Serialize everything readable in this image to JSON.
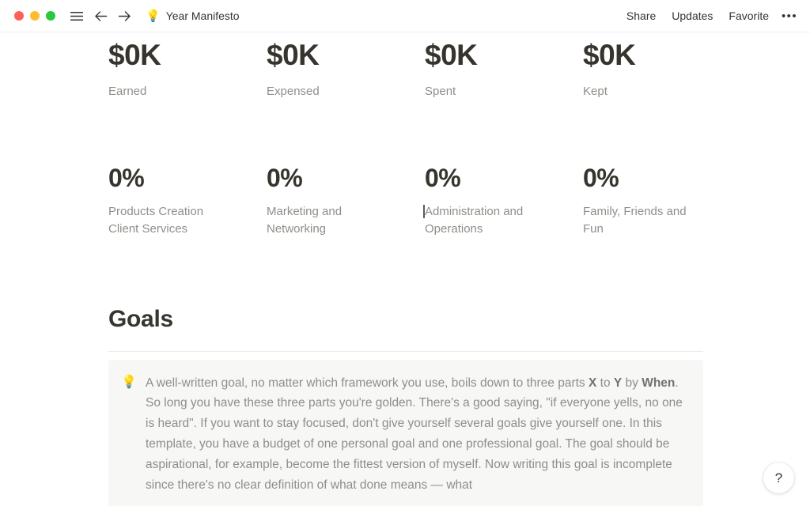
{
  "window": {
    "traffic_lights": [
      {
        "name": "close",
        "color": "#ff5f57"
      },
      {
        "name": "minimize",
        "color": "#febc2e"
      },
      {
        "name": "maximize",
        "color": "#28c840"
      }
    ],
    "menu_icon": "hamburger-icon",
    "back_icon": "arrow-left-icon",
    "forward_icon": "arrow-right-icon",
    "doc_emoji": "💡",
    "doc_title": "Year Manifesto",
    "actions": [
      {
        "name": "share",
        "label": "Share"
      },
      {
        "name": "updates",
        "label": "Updates"
      },
      {
        "name": "favorite",
        "label": "Favorite"
      }
    ],
    "more_label": "•••"
  },
  "stats_money": [
    {
      "value": "$0K",
      "label": "Earned"
    },
    {
      "value": "$0K",
      "label": "Expensed"
    },
    {
      "value": "$0K",
      "label": "Spent"
    },
    {
      "value": "$0K",
      "label": "Kept"
    }
  ],
  "stats_percent": [
    {
      "value": "0%",
      "label": "Products Creation Client Services"
    },
    {
      "value": "0%",
      "label": "Marketing and Networking"
    },
    {
      "value": "0%",
      "label": "Administration and Operations"
    },
    {
      "value": "0%",
      "label": "Family, Friends and Fun"
    }
  ],
  "goals": {
    "heading": "Goals",
    "callout_emoji": "💡",
    "callout": {
      "p1": "A well-written goal, no matter which framework you use, boils down to three parts ",
      "b1": "X",
      "p2": " to ",
      "b2": "Y",
      "p3": " by ",
      "b3": "When",
      "p4": ". So long you have these three parts you're golden. There's a good saying, \"if everyone yells, no one is heard\". If you want to stay focused, don't give yourself several goals give yourself one. In this template, you have a budget of one personal goal and one professional goal. The goal should be aspirational, for example, become the fittest version of myself. Now writing this goal is incomplete since there's no clear definition of what done means — what"
    }
  },
  "help": {
    "label": "?"
  },
  "colors": {
    "text": "#37352f",
    "muted": "#908e89",
    "callout_bg": "#f7f7f5",
    "divider": "#eceae6"
  }
}
